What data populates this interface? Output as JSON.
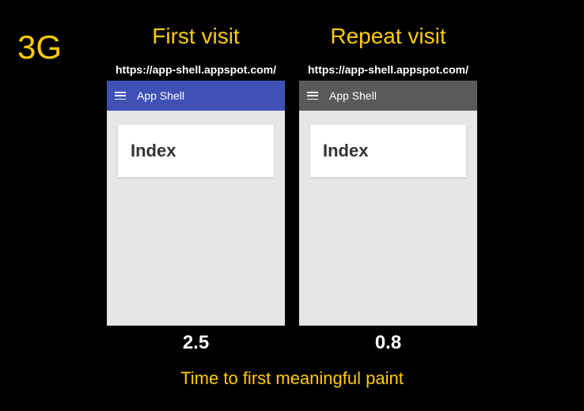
{
  "network_type": "3G",
  "columns": {
    "first": {
      "title": "First visit",
      "url": "https://app-shell.appspot.com/",
      "app_title": "App Shell",
      "card_label": "Index",
      "timing_seconds": "2.5"
    },
    "repeat": {
      "title": "Repeat visit",
      "url": "https://app-shell.appspot.com/",
      "app_title": "App Shell",
      "card_label": "Index",
      "timing_seconds": "0.8"
    }
  },
  "footer_caption": "Time to first meaningful paint"
}
